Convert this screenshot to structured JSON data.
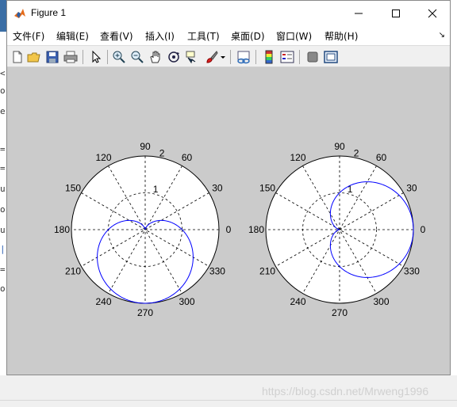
{
  "window": {
    "title": "Figure 1",
    "menu": [
      {
        "label": "文件(F)"
      },
      {
        "label": "编辑(E)"
      },
      {
        "label": "查看(V)"
      },
      {
        "label": "插入(I)"
      },
      {
        "label": "工具(T)"
      },
      {
        "label": "桌面(D)"
      },
      {
        "label": "窗口(W)"
      },
      {
        "label": "帮助(H)"
      }
    ]
  },
  "toolbar": {
    "icons": [
      "new-figure-icon",
      "open-file-icon",
      "save-icon",
      "print-icon",
      "edit-plot-arrow-icon",
      "zoom-in-icon",
      "zoom-out-icon",
      "pan-hand-icon",
      "rotate-3d-icon",
      "data-cursor-icon",
      "brush-icon",
      "link-plot-icon",
      "colorbar-icon",
      "legend-icon",
      "hide-plot-tools-icon",
      "show-plot-tools-icon"
    ]
  },
  "polar_plots": [
    {
      "angle_labels": [
        "0",
        "30",
        "60",
        "90",
        "120",
        "150",
        "180",
        "210",
        "240",
        "270",
        "300",
        "330"
      ],
      "radial_labels": [
        "1",
        "2"
      ],
      "rmax": 2,
      "curve": "cardioid-down",
      "line_color": "#0000ff"
    },
    {
      "angle_labels": [
        "0",
        "30",
        "60",
        "90",
        "120",
        "150",
        "180",
        "210",
        "240",
        "270",
        "300",
        "330"
      ],
      "radial_labels": [
        "1",
        "2"
      ],
      "rmax": 2,
      "curve": "cardioid-right",
      "line_color": "#0000ff"
    }
  ],
  "watermark": "https://blog.csdn.net/Mrweng1996"
}
